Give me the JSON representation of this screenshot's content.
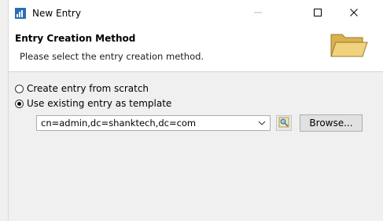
{
  "window": {
    "title": "New Entry",
    "icon": "app-icon",
    "controls": [
      "minimize-icon",
      "maximize-icon",
      "close-icon"
    ]
  },
  "header": {
    "title": "Entry Creation Method",
    "description": "Please select the entry creation method.",
    "icon": "folder-icon"
  },
  "options": {
    "scratch_label": "Create entry from scratch",
    "scratch_selected": false,
    "template_label": "Use existing entry as template",
    "template_selected": true
  },
  "template_combo": {
    "value": "cn=admin,dc=shanktech,dc=com"
  },
  "buttons": {
    "browse_label": "Browse..."
  },
  "colors": {
    "window_bg": "#ffffff",
    "body_bg": "#f0f0f0",
    "folder_yellow": "#e9c76a"
  }
}
